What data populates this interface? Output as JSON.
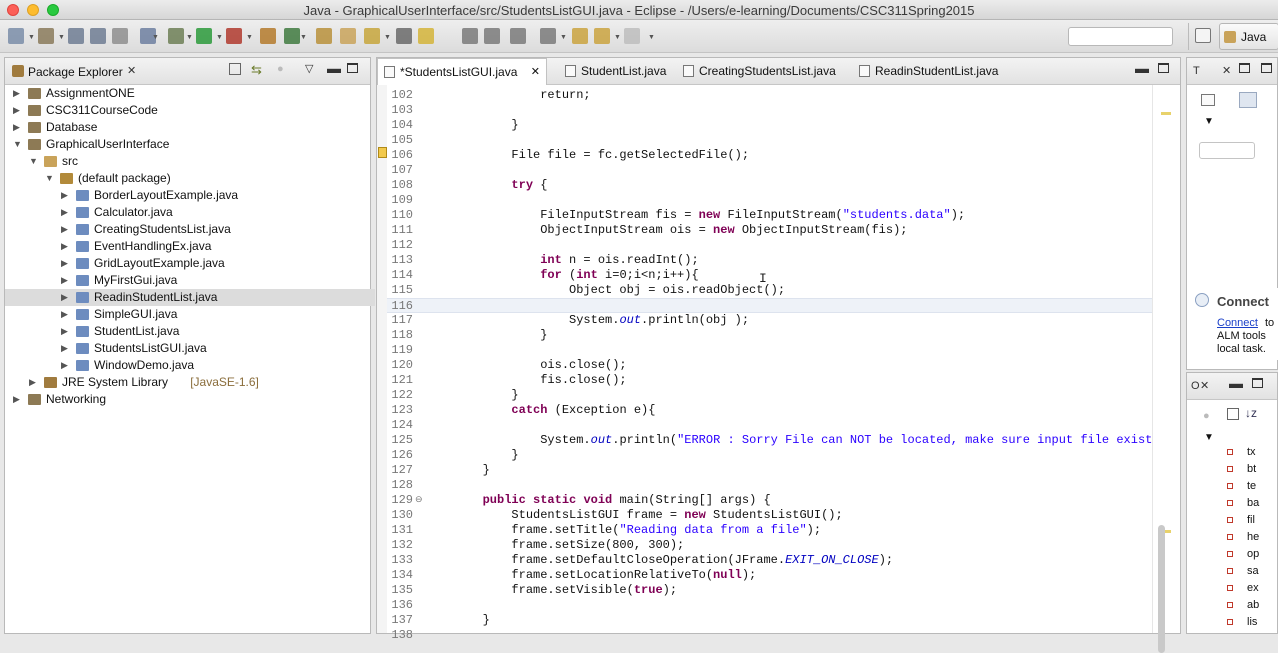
{
  "window": {
    "title": "Java - GraphicalUserInterface/src/StudentsListGUI.java - Eclipse - /Users/e-learning/Documents/CSC311Spring2015"
  },
  "toolbar": {
    "perspective_label": "Java",
    "quick_access_placeholder": ""
  },
  "package_explorer": {
    "title": "Package Explorer",
    "items": [
      {
        "label": "AssignmentONE",
        "depth": 0,
        "expanded": false,
        "kind": "project"
      },
      {
        "label": "CSC311CourseCode",
        "depth": 0,
        "expanded": false,
        "kind": "project"
      },
      {
        "label": "Database",
        "depth": 0,
        "expanded": false,
        "kind": "project"
      },
      {
        "label": "GraphicalUserInterface",
        "depth": 0,
        "expanded": true,
        "kind": "project"
      },
      {
        "label": "src",
        "depth": 1,
        "expanded": true,
        "kind": "folder"
      },
      {
        "label": "(default package)",
        "depth": 2,
        "expanded": true,
        "kind": "package"
      },
      {
        "label": "BorderLayoutExample.java",
        "depth": 3,
        "expanded": false,
        "kind": "file"
      },
      {
        "label": "Calculator.java",
        "depth": 3,
        "expanded": false,
        "kind": "file"
      },
      {
        "label": "CreatingStudentsList.java",
        "depth": 3,
        "expanded": false,
        "kind": "file"
      },
      {
        "label": "EventHandlingEx.java",
        "depth": 3,
        "expanded": false,
        "kind": "file"
      },
      {
        "label": "GridLayoutExample.java",
        "depth": 3,
        "expanded": false,
        "kind": "file"
      },
      {
        "label": "MyFirstGui.java",
        "depth": 3,
        "expanded": false,
        "kind": "file"
      },
      {
        "label": "ReadinStudentList.java",
        "depth": 3,
        "expanded": false,
        "kind": "file",
        "selected": true
      },
      {
        "label": "SimpleGUI.java",
        "depth": 3,
        "expanded": false,
        "kind": "file"
      },
      {
        "label": "StudentList.java",
        "depth": 3,
        "expanded": false,
        "kind": "file"
      },
      {
        "label": "StudentsListGUI.java",
        "depth": 3,
        "expanded": false,
        "kind": "file"
      },
      {
        "label": "WindowDemo.java",
        "depth": 3,
        "expanded": false,
        "kind": "file"
      },
      {
        "label": "JRE System Library",
        "suffix": "[JavaSE-1.6]",
        "depth": 1,
        "expanded": false,
        "kind": "library"
      },
      {
        "label": "Networking",
        "depth": 0,
        "expanded": false,
        "kind": "project"
      }
    ]
  },
  "editor": {
    "tabs": [
      {
        "label": "*StudentsListGUI.java",
        "active": true
      },
      {
        "label": "StudentList.java",
        "active": false
      },
      {
        "label": "CreatingStudentsList.java",
        "active": false
      },
      {
        "label": "ReadinStudentList.java",
        "active": false
      }
    ],
    "lines": [
      {
        "n": "102",
        "segs": [
          [
            "p",
            "                return;"
          ]
        ]
      },
      {
        "n": "103",
        "segs": [
          [
            "p",
            ""
          ]
        ]
      },
      {
        "n": "104",
        "segs": [
          [
            "p",
            "            }"
          ]
        ]
      },
      {
        "n": "105",
        "segs": [
          [
            "p",
            ""
          ]
        ]
      },
      {
        "n": "106",
        "segs": [
          [
            "p",
            "            File file = fc.getSelectedFile();"
          ]
        ]
      },
      {
        "n": "107",
        "segs": [
          [
            "p",
            ""
          ]
        ]
      },
      {
        "n": "108",
        "segs": [
          [
            "p",
            "            "
          ],
          [
            "k",
            "try"
          ],
          [
            "p",
            " {"
          ]
        ]
      },
      {
        "n": "109",
        "segs": [
          [
            "p",
            ""
          ]
        ]
      },
      {
        "n": "110",
        "segs": [
          [
            "p",
            "                FileInputStream fis = "
          ],
          [
            "k",
            "new"
          ],
          [
            "p",
            " FileInputStream("
          ],
          [
            "s",
            "\"students.data\""
          ],
          [
            "p",
            ");"
          ]
        ]
      },
      {
        "n": "111",
        "segs": [
          [
            "p",
            "                ObjectInputStream ois = "
          ],
          [
            "k",
            "new"
          ],
          [
            "p",
            " ObjectInputStream(fis);"
          ]
        ]
      },
      {
        "n": "112",
        "segs": [
          [
            "p",
            ""
          ]
        ]
      },
      {
        "n": "113",
        "segs": [
          [
            "p",
            "                "
          ],
          [
            "k",
            "int"
          ],
          [
            "p",
            " n = ois.readInt();"
          ]
        ]
      },
      {
        "n": "114",
        "segs": [
          [
            "p",
            "                "
          ],
          [
            "k",
            "for"
          ],
          [
            "p",
            " ("
          ],
          [
            "k",
            "int"
          ],
          [
            "p",
            " i=0;i<n;i++){"
          ]
        ]
      },
      {
        "n": "115",
        "segs": [
          [
            "p",
            "                    Object obj = ois.readObject();"
          ]
        ]
      },
      {
        "n": "116",
        "segs": [
          [
            "p",
            ""
          ]
        ],
        "current": true
      },
      {
        "n": "117",
        "segs": [
          [
            "p",
            "                    System."
          ],
          [
            "i",
            "out"
          ],
          [
            "p",
            ".println(obj );"
          ]
        ]
      },
      {
        "n": "118",
        "segs": [
          [
            "p",
            "                }"
          ]
        ]
      },
      {
        "n": "119",
        "segs": [
          [
            "p",
            ""
          ]
        ]
      },
      {
        "n": "120",
        "segs": [
          [
            "p",
            "                ois.close();"
          ]
        ]
      },
      {
        "n": "121",
        "segs": [
          [
            "p",
            "                fis.close();"
          ]
        ]
      },
      {
        "n": "122",
        "segs": [
          [
            "p",
            "            }"
          ]
        ]
      },
      {
        "n": "123",
        "segs": [
          [
            "p",
            "            "
          ],
          [
            "k",
            "catch"
          ],
          [
            "p",
            " (Exception e){"
          ]
        ]
      },
      {
        "n": "124",
        "segs": [
          [
            "p",
            ""
          ]
        ]
      },
      {
        "n": "125",
        "segs": [
          [
            "p",
            "                System."
          ],
          [
            "i",
            "out"
          ],
          [
            "p",
            ".println("
          ],
          [
            "s",
            "\"ERROR : Sorry File can NOT be located, make sure input file exists\""
          ],
          [
            "p",
            ");"
          ]
        ]
      },
      {
        "n": "126",
        "segs": [
          [
            "p",
            "            }"
          ]
        ]
      },
      {
        "n": "127",
        "segs": [
          [
            "p",
            "        }"
          ]
        ]
      },
      {
        "n": "128",
        "segs": [
          [
            "p",
            ""
          ]
        ]
      },
      {
        "n": "129",
        "segs": [
          [
            "p",
            "        "
          ],
          [
            "k",
            "public"
          ],
          [
            "p",
            " "
          ],
          [
            "k",
            "static"
          ],
          [
            "p",
            " "
          ],
          [
            "k",
            "void"
          ],
          [
            "p",
            " main(String[] args) {"
          ]
        ]
      },
      {
        "n": "130",
        "segs": [
          [
            "p",
            "            StudentsListGUI frame = "
          ],
          [
            "k",
            "new"
          ],
          [
            "p",
            " StudentsListGUI();"
          ]
        ]
      },
      {
        "n": "131",
        "segs": [
          [
            "p",
            "            frame.setTitle("
          ],
          [
            "s",
            "\"Reading data from a file\""
          ],
          [
            "p",
            ");"
          ]
        ]
      },
      {
        "n": "132",
        "segs": [
          [
            "p",
            "            frame.setSize(800, 300);"
          ]
        ]
      },
      {
        "n": "133",
        "segs": [
          [
            "p",
            "            frame.setDefaultCloseOperation(JFrame."
          ],
          [
            "i",
            "EXIT_ON_CLOSE"
          ],
          [
            "p",
            ");"
          ]
        ]
      },
      {
        "n": "134",
        "segs": [
          [
            "p",
            "            frame.setLocationRelativeTo("
          ],
          [
            "k",
            "null"
          ],
          [
            "p",
            ");"
          ]
        ]
      },
      {
        "n": "135",
        "segs": [
          [
            "p",
            "            frame.setVisible("
          ],
          [
            "k",
            "true"
          ],
          [
            "p",
            ");"
          ]
        ]
      },
      {
        "n": "136",
        "segs": [
          [
            "p",
            ""
          ]
        ]
      },
      {
        "n": "137",
        "segs": [
          [
            "p",
            "        }"
          ]
        ]
      },
      {
        "n": "138",
        "segs": [
          [
            "p",
            ""
          ]
        ]
      }
    ]
  },
  "task_panel": {
    "tab_label": "T",
    "connect_heading": "Connect",
    "link": "Connect",
    "link_rest": "to",
    "text1": "ALM tools",
    "text2": "local task."
  },
  "outline_panel": {
    "tab_label": "O",
    "items": [
      "tx",
      "bt",
      "te",
      "ba",
      "fil",
      "he",
      "op",
      "sa",
      "ex",
      "ab",
      "lis"
    ]
  }
}
